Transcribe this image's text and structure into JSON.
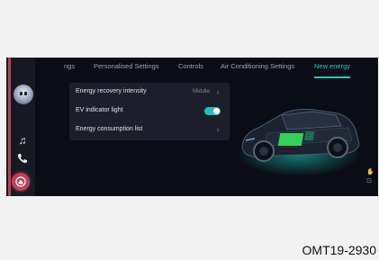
{
  "tabs": [
    {
      "label": "ngs"
    },
    {
      "label": "Personalised Settings"
    },
    {
      "label": "Controls"
    },
    {
      "label": "Air Conditioning Settings"
    },
    {
      "label": "New energy",
      "active": true
    }
  ],
  "panel": {
    "energy_recovery": {
      "label": "Energy recovery intensity",
      "value": "Middle"
    },
    "ev_indicator": {
      "label": "EV indicator light",
      "enabled": true
    },
    "energy_consumption": {
      "label": "Energy consumption list"
    }
  },
  "sidebar": {
    "icons": [
      "assistant-avatar-icon",
      "music-note-icon",
      "phone-icon",
      "home-icon"
    ]
  },
  "colors": {
    "accent": "#21c8c4",
    "home_button": "#c0405a",
    "background": "#0b0d16"
  },
  "caption": "OMT19-2930"
}
